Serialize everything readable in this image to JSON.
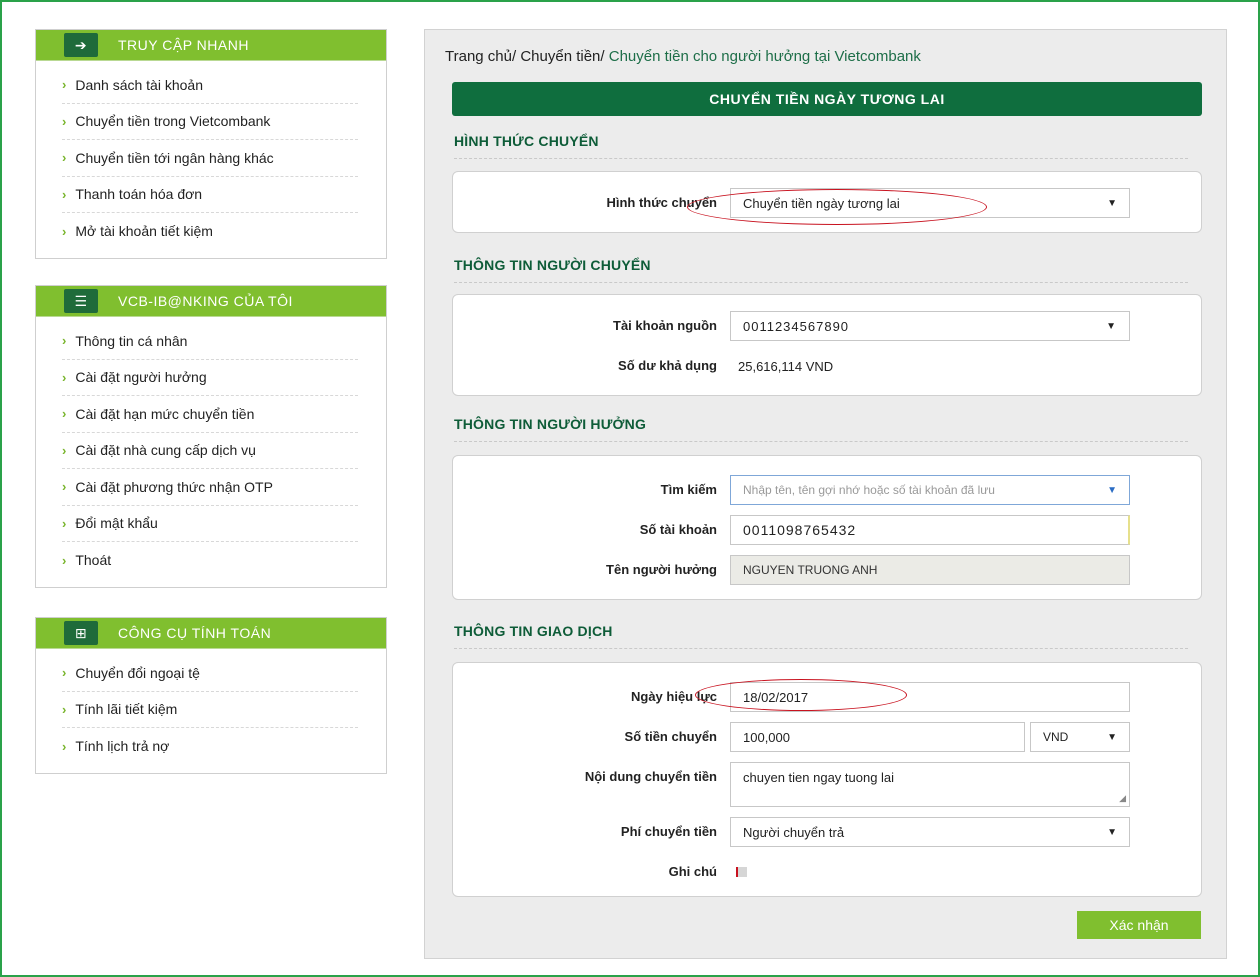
{
  "sidebar": {
    "quick_access": {
      "title": "TRUY CẬP NHANH",
      "items": [
        "Danh sách tài khoản",
        "Chuyển tiền trong Vietcombank",
        "Chuyển tiền tới ngân hàng khác",
        "Thanh toán hóa đơn",
        "Mở tài khoản tiết kiệm"
      ]
    },
    "my_ibanking": {
      "title": "VCB-IB@NKING CỦA TÔI",
      "items": [
        "Thông tin cá nhân",
        "Cài đặt người hưởng",
        "Cài đặt hạn mức chuyển tiền",
        "Cài đặt nhà cung cấp dịch vụ",
        "Cài đặt phương thức nhận OTP",
        "Đổi mật khẩu",
        "Thoát"
      ]
    },
    "tools": {
      "title": "CÔNG CỤ TÍNH TOÁN",
      "items": [
        "Chuyển đổi ngoại tệ",
        "Tính lãi tiết kiệm",
        "Tính lịch trả nợ"
      ]
    }
  },
  "breadcrumb": {
    "home": "Trang chủ/",
    "transfer": "Chuyển tiền/",
    "current": "Chuyển tiền cho người hưởng tại Vietcombank"
  },
  "page_title": "CHUYỂN TIỀN NGÀY TƯƠNG LAI",
  "sections": {
    "method": {
      "title": "HÌNH THỨC CHUYỂN",
      "label": "Hình thức chuyển",
      "value": "Chuyển tiền ngày tương lai"
    },
    "sender": {
      "title": "THÔNG TIN NGƯỜI CHUYỂN",
      "source_label": "Tài khoản nguồn",
      "source_value": "0011234567890",
      "balance_label": "Số dư khả dụng",
      "balance_value": "25,616,114 VND"
    },
    "beneficiary": {
      "title": "THÔNG TIN NGƯỜI HƯỞNG",
      "search_label": "Tìm kiếm",
      "search_placeholder": "Nhập tên, tên gợi nhớ hoặc số tài khoản đã lưu",
      "account_label": "Số tài khoản",
      "account_value": "0011098765432",
      "name_label": "Tên người hưởng",
      "name_value": "NGUYEN TRUONG ANH"
    },
    "transaction": {
      "title": "THÔNG TIN GIAO DỊCH",
      "date_label": "Ngày hiệu lực",
      "date_value": "18/02/2017",
      "amount_label": "Số tiền chuyển",
      "amount_value": "100,000",
      "currency": "VND",
      "content_label": "Nội dung chuyển tiền",
      "content_value": "chuyen tien ngay tuong lai",
      "fee_label": "Phí chuyển tiền",
      "fee_value": "Người chuyển trả",
      "note_label": "Ghi chú"
    }
  },
  "confirm_label": "Xác nhận",
  "colors": {
    "accent_green": "#80bf2f",
    "dark_green": "#0f6e3e",
    "highlight_red": "#c8121f"
  }
}
